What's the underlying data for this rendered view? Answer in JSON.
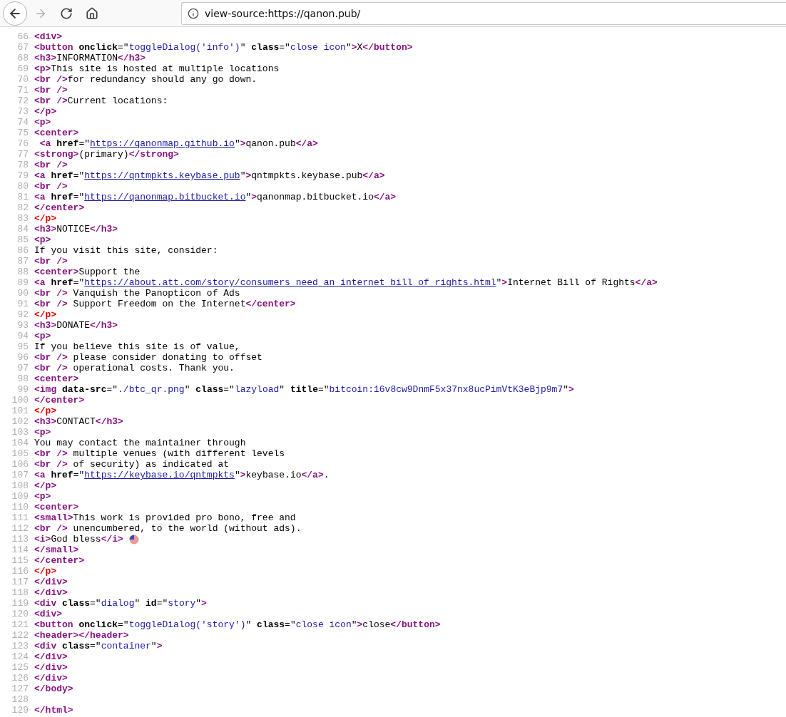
{
  "toolbar": {
    "nav": [
      {
        "kind": "back",
        "disabled": false
      },
      {
        "kind": "forward",
        "disabled": true
      },
      {
        "kind": "reload",
        "disabled": false
      },
      {
        "kind": "home",
        "disabled": false
      }
    ],
    "address": "view-source:https://qanon.pub/"
  },
  "lines": [
    {
      "number": "66",
      "tokens": [
        {
          "kind": "tag",
          "text": "<div>"
        }
      ]
    },
    {
      "number": "67",
      "tokens": [
        {
          "kind": "tag",
          "text": "<button"
        },
        {
          "kind": "attr",
          "text": " onclick"
        },
        {
          "kind": "text",
          "text": "=\""
        },
        {
          "kind": "value",
          "text": "toggleDialog('info')"
        },
        {
          "kind": "text",
          "text": "\""
        },
        {
          "kind": "attr",
          "text": " class"
        },
        {
          "kind": "text",
          "text": "=\""
        },
        {
          "kind": "value",
          "text": "close icon"
        },
        {
          "kind": "text",
          "text": "\""
        },
        {
          "kind": "tag",
          "text": ">"
        },
        {
          "kind": "text",
          "text": "X"
        },
        {
          "kind": "tag",
          "text": "</button>"
        }
      ]
    },
    {
      "number": "68",
      "tokens": [
        {
          "kind": "tag",
          "text": "<h3>"
        },
        {
          "kind": "text",
          "text": "INFORMATION"
        },
        {
          "kind": "tag",
          "text": "</h3>"
        }
      ]
    },
    {
      "number": "69",
      "tokens": [
        {
          "kind": "tag",
          "text": "<p>"
        },
        {
          "kind": "text",
          "text": "This site is hosted at multiple locations"
        }
      ]
    },
    {
      "number": "70",
      "tokens": [
        {
          "kind": "tag",
          "text": "<br />"
        },
        {
          "kind": "text",
          "text": "for redundancy should any go down."
        }
      ]
    },
    {
      "number": "71",
      "tokens": [
        {
          "kind": "tag",
          "text": "<br />"
        }
      ]
    },
    {
      "number": "72",
      "tokens": [
        {
          "kind": "tag",
          "text": "<br />"
        },
        {
          "kind": "text",
          "text": "Current locations:"
        }
      ]
    },
    {
      "number": "73",
      "tokens": [
        {
          "kind": "tag",
          "text": "</p>"
        }
      ]
    },
    {
      "number": "74",
      "tokens": [
        {
          "kind": "tag",
          "text": "<p>"
        }
      ]
    },
    {
      "number": "75",
      "tokens": [
        {
          "kind": "tag",
          "text": "<center>"
        }
      ]
    },
    {
      "number": "76",
      "tokens": [
        {
          "kind": "tag",
          "text": " <a"
        },
        {
          "kind": "attr",
          "text": " href"
        },
        {
          "kind": "text",
          "text": "=\""
        },
        {
          "kind": "link",
          "text": "https://qanonmap.github.io"
        },
        {
          "kind": "text",
          "text": "\""
        },
        {
          "kind": "tag",
          "text": ">"
        },
        {
          "kind": "text",
          "text": "qanon.pub"
        },
        {
          "kind": "tag",
          "text": "</a>"
        }
      ]
    },
    {
      "number": "77",
      "tokens": [
        {
          "kind": "tag",
          "text": "<strong>"
        },
        {
          "kind": "text",
          "text": "(primary)"
        },
        {
          "kind": "tag",
          "text": "</strong>"
        }
      ]
    },
    {
      "number": "78",
      "tokens": [
        {
          "kind": "tag",
          "text": "<br />"
        }
      ]
    },
    {
      "number": "79",
      "tokens": [
        {
          "kind": "tag",
          "text": "<a"
        },
        {
          "kind": "attr",
          "text": " href"
        },
        {
          "kind": "text",
          "text": "=\""
        },
        {
          "kind": "link",
          "text": "https://qntmpkts.keybase.pub"
        },
        {
          "kind": "text",
          "text": "\""
        },
        {
          "kind": "tag",
          "text": ">"
        },
        {
          "kind": "text",
          "text": "qntmpkts.keybase.pub"
        },
        {
          "kind": "tag",
          "text": "</a>"
        }
      ]
    },
    {
      "number": "80",
      "tokens": [
        {
          "kind": "tag",
          "text": "<br />"
        }
      ]
    },
    {
      "number": "81",
      "tokens": [
        {
          "kind": "tag",
          "text": "<a"
        },
        {
          "kind": "attr",
          "text": " href"
        },
        {
          "kind": "text",
          "text": "=\""
        },
        {
          "kind": "link",
          "text": "https://qanonmap.bitbucket.io"
        },
        {
          "kind": "text",
          "text": "\""
        },
        {
          "kind": "tag",
          "text": ">"
        },
        {
          "kind": "text",
          "text": "qanonmap.bitbucket.io"
        },
        {
          "kind": "tag",
          "text": "</a>"
        }
      ]
    },
    {
      "number": "82",
      "tokens": [
        {
          "kind": "tag",
          "text": "</center>"
        }
      ]
    },
    {
      "number": "83",
      "tokens": [
        {
          "kind": "error",
          "text": "</p>"
        }
      ]
    },
    {
      "number": "84",
      "tokens": [
        {
          "kind": "tag",
          "text": "<h3>"
        },
        {
          "kind": "text",
          "text": "NOTICE"
        },
        {
          "kind": "tag",
          "text": "</h3>"
        }
      ]
    },
    {
      "number": "85",
      "tokens": [
        {
          "kind": "tag",
          "text": "<p>"
        }
      ]
    },
    {
      "number": "86",
      "tokens": [
        {
          "kind": "text",
          "text": "If you visit this site, consider:"
        }
      ]
    },
    {
      "number": "87",
      "tokens": [
        {
          "kind": "tag",
          "text": "<br />"
        }
      ]
    },
    {
      "number": "88",
      "tokens": [
        {
          "kind": "tag",
          "text": "<center>"
        },
        {
          "kind": "text",
          "text": "Support the"
        }
      ]
    },
    {
      "number": "89",
      "tokens": [
        {
          "kind": "tag",
          "text": "<a"
        },
        {
          "kind": "attr",
          "text": " href"
        },
        {
          "kind": "text",
          "text": "=\""
        },
        {
          "kind": "link",
          "text": "https://about.att.com/story/consumers need an internet bill of rights.html"
        },
        {
          "kind": "text",
          "text": "\""
        },
        {
          "kind": "tag",
          "text": ">"
        },
        {
          "kind": "text",
          "text": "Internet Bill of Rights"
        },
        {
          "kind": "tag",
          "text": "</a>"
        }
      ]
    },
    {
      "number": "90",
      "tokens": [
        {
          "kind": "tag",
          "text": "<br />"
        },
        {
          "kind": "text",
          "text": " Vanquish the Panopticon of Ads"
        }
      ]
    },
    {
      "number": "91",
      "tokens": [
        {
          "kind": "tag",
          "text": "<br />"
        },
        {
          "kind": "text",
          "text": " Support Freedom on the Internet"
        },
        {
          "kind": "tag",
          "text": "</center>"
        }
      ]
    },
    {
      "number": "92",
      "tokens": [
        {
          "kind": "error",
          "text": "</p>"
        }
      ]
    },
    {
      "number": "93",
      "tokens": [
        {
          "kind": "tag",
          "text": "<h3>"
        },
        {
          "kind": "text",
          "text": "DONATE"
        },
        {
          "kind": "tag",
          "text": "</h3>"
        }
      ]
    },
    {
      "number": "94",
      "tokens": [
        {
          "kind": "tag",
          "text": "<p>"
        }
      ]
    },
    {
      "number": "95",
      "tokens": [
        {
          "kind": "text",
          "text": "If you believe this site is of value,"
        }
      ]
    },
    {
      "number": "96",
      "tokens": [
        {
          "kind": "tag",
          "text": "<br />"
        },
        {
          "kind": "text",
          "text": " please consider donating to offset"
        }
      ]
    },
    {
      "number": "97",
      "tokens": [
        {
          "kind": "tag",
          "text": "<br />"
        },
        {
          "kind": "text",
          "text": " operational costs. Thank you."
        }
      ]
    },
    {
      "number": "98",
      "tokens": [
        {
          "kind": "tag",
          "text": "<center>"
        }
      ]
    },
    {
      "number": "99",
      "tokens": [
        {
          "kind": "tag",
          "text": "<img"
        },
        {
          "kind": "attr",
          "text": " data-src"
        },
        {
          "kind": "text",
          "text": "=\""
        },
        {
          "kind": "value",
          "text": "./btc_qr.png"
        },
        {
          "kind": "text",
          "text": "\""
        },
        {
          "kind": "attr",
          "text": " class"
        },
        {
          "kind": "text",
          "text": "=\""
        },
        {
          "kind": "value",
          "text": "lazyload"
        },
        {
          "kind": "text",
          "text": "\""
        },
        {
          "kind": "attr",
          "text": " title"
        },
        {
          "kind": "text",
          "text": "=\""
        },
        {
          "kind": "value",
          "text": "bitcoin:16v8cw9DnmF5x37nx8ucPimVtK3eBjp9m7"
        },
        {
          "kind": "text",
          "text": "\""
        },
        {
          "kind": "tag",
          "text": ">"
        }
      ]
    },
    {
      "number": "100",
      "tokens": [
        {
          "kind": "tag",
          "text": "</center>"
        }
      ]
    },
    {
      "number": "101",
      "tokens": [
        {
          "kind": "error",
          "text": "</p>"
        }
      ]
    },
    {
      "number": "102",
      "tokens": [
        {
          "kind": "tag",
          "text": "<h3>"
        },
        {
          "kind": "text",
          "text": "CONTACT"
        },
        {
          "kind": "tag",
          "text": "</h3>"
        }
      ]
    },
    {
      "number": "103",
      "tokens": [
        {
          "kind": "tag",
          "text": "<p>"
        }
      ]
    },
    {
      "number": "104",
      "tokens": [
        {
          "kind": "text",
          "text": "You may contact the maintainer through"
        }
      ]
    },
    {
      "number": "105",
      "tokens": [
        {
          "kind": "tag",
          "text": "<br />"
        },
        {
          "kind": "text",
          "text": " multiple venues (with different levels"
        }
      ]
    },
    {
      "number": "106",
      "tokens": [
        {
          "kind": "tag",
          "text": "<br />"
        },
        {
          "kind": "text",
          "text": " of security) as indicated at"
        }
      ]
    },
    {
      "number": "107",
      "tokens": [
        {
          "kind": "tag",
          "text": "<a"
        },
        {
          "kind": "attr",
          "text": " href"
        },
        {
          "kind": "text",
          "text": "=\""
        },
        {
          "kind": "link",
          "text": "https://keybase.io/qntmpkts"
        },
        {
          "kind": "text",
          "text": "\""
        },
        {
          "kind": "tag",
          "text": ">"
        },
        {
          "kind": "text",
          "text": "keybase.io"
        },
        {
          "kind": "tag",
          "text": "</a>"
        },
        {
          "kind": "text",
          "text": "."
        }
      ]
    },
    {
      "number": "108",
      "tokens": [
        {
          "kind": "tag",
          "text": "</p>"
        }
      ]
    },
    {
      "number": "109",
      "tokens": [
        {
          "kind": "tag",
          "text": "<p>"
        }
      ]
    },
    {
      "number": "110",
      "tokens": [
        {
          "kind": "tag",
          "text": "<center>"
        }
      ]
    },
    {
      "number": "111",
      "tokens": [
        {
          "kind": "tag",
          "text": "<small>"
        },
        {
          "kind": "text",
          "text": "This work is provided pro bono, free and"
        }
      ]
    },
    {
      "number": "112",
      "tokens": [
        {
          "kind": "tag",
          "text": "<br />"
        },
        {
          "kind": "text",
          "text": " unencumbered, to the world (without ads)."
        }
      ]
    },
    {
      "number": "113",
      "tokens": [
        {
          "kind": "tag",
          "text": "<i>"
        },
        {
          "kind": "text",
          "text": "God bless"
        },
        {
          "kind": "tag",
          "text": "</i>"
        },
        {
          "kind": "flag"
        }
      ]
    },
    {
      "number": "114",
      "tokens": [
        {
          "kind": "tag",
          "text": "</small>"
        }
      ]
    },
    {
      "number": "115",
      "tokens": [
        {
          "kind": "tag",
          "text": "</center>"
        }
      ]
    },
    {
      "number": "116",
      "tokens": [
        {
          "kind": "error",
          "text": "</p>"
        }
      ]
    },
    {
      "number": "117",
      "tokens": [
        {
          "kind": "tag",
          "text": "</div>"
        }
      ]
    },
    {
      "number": "118",
      "tokens": [
        {
          "kind": "tag",
          "text": "</div>"
        }
      ]
    },
    {
      "number": "119",
      "tokens": [
        {
          "kind": "tag",
          "text": "<div"
        },
        {
          "kind": "attr",
          "text": " class"
        },
        {
          "kind": "text",
          "text": "=\""
        },
        {
          "kind": "value",
          "text": "dialog"
        },
        {
          "kind": "text",
          "text": "\""
        },
        {
          "kind": "attr",
          "text": " id"
        },
        {
          "kind": "text",
          "text": "=\""
        },
        {
          "kind": "value",
          "text": "story"
        },
        {
          "kind": "text",
          "text": "\""
        },
        {
          "kind": "tag",
          "text": ">"
        }
      ]
    },
    {
      "number": "120",
      "tokens": [
        {
          "kind": "tag",
          "text": "<div>"
        }
      ]
    },
    {
      "number": "121",
      "tokens": [
        {
          "kind": "tag",
          "text": "<button"
        },
        {
          "kind": "attr",
          "text": " onclick"
        },
        {
          "kind": "text",
          "text": "=\""
        },
        {
          "kind": "value",
          "text": "toggleDialog('story')"
        },
        {
          "kind": "text",
          "text": "\""
        },
        {
          "kind": "attr",
          "text": " class"
        },
        {
          "kind": "text",
          "text": "=\""
        },
        {
          "kind": "value",
          "text": "close icon"
        },
        {
          "kind": "text",
          "text": "\""
        },
        {
          "kind": "tag",
          "text": ">"
        },
        {
          "kind": "text",
          "text": "close"
        },
        {
          "kind": "tag",
          "text": "</button>"
        }
      ]
    },
    {
      "number": "122",
      "tokens": [
        {
          "kind": "tag",
          "text": "<header>"
        },
        {
          "kind": "tag",
          "text": "</header>"
        }
      ]
    },
    {
      "number": "123",
      "tokens": [
        {
          "kind": "tag",
          "text": "<div"
        },
        {
          "kind": "attr",
          "text": " class"
        },
        {
          "kind": "text",
          "text": "=\""
        },
        {
          "kind": "value",
          "text": "container"
        },
        {
          "kind": "text",
          "text": "\""
        },
        {
          "kind": "tag",
          "text": ">"
        }
      ]
    },
    {
      "number": "124",
      "tokens": [
        {
          "kind": "tag",
          "text": "</div>"
        }
      ]
    },
    {
      "number": "125",
      "tokens": [
        {
          "kind": "tag",
          "text": "</div>"
        }
      ]
    },
    {
      "number": "126",
      "tokens": [
        {
          "kind": "tag",
          "text": "</div>"
        }
      ]
    },
    {
      "number": "127",
      "tokens": [
        {
          "kind": "tag",
          "text": "</body>"
        }
      ]
    },
    {
      "number": "128"
    },
    {
      "number": "129",
      "tokens": [
        {
          "kind": "tag",
          "text": "</html>"
        }
      ]
    }
  ]
}
